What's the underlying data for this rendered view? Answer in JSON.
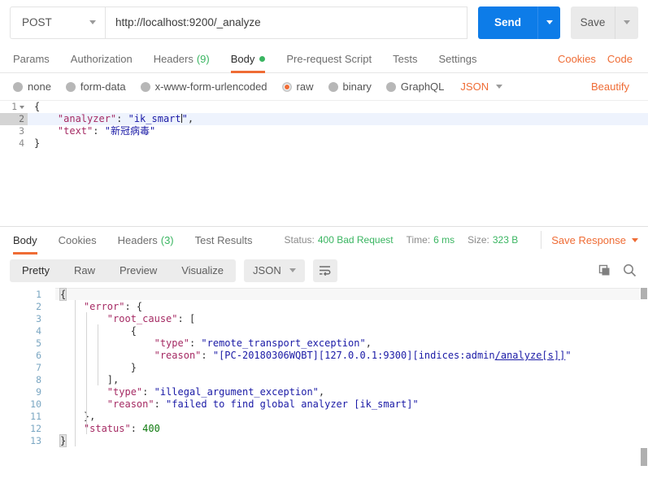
{
  "request": {
    "method": "POST",
    "url": "http://localhost:9200/_analyze",
    "send_label": "Send",
    "save_label": "Save",
    "tabs": [
      {
        "label": "Params",
        "count": "",
        "active": false,
        "dot": false
      },
      {
        "label": "Authorization",
        "count": "",
        "active": false,
        "dot": false
      },
      {
        "label": "Headers",
        "count": "(9)",
        "active": false,
        "dot": false
      },
      {
        "label": "Body",
        "count": "",
        "active": true,
        "dot": true
      },
      {
        "label": "Pre-request Script",
        "count": "",
        "active": false,
        "dot": false
      },
      {
        "label": "Tests",
        "count": "",
        "active": false,
        "dot": false
      },
      {
        "label": "Settings",
        "count": "",
        "active": false,
        "dot": false
      }
    ],
    "cookies_label": "Cookies",
    "code_label": "Code",
    "body_types": [
      {
        "label": "none",
        "selected": false
      },
      {
        "label": "form-data",
        "selected": false
      },
      {
        "label": "x-www-form-urlencoded",
        "selected": false
      },
      {
        "label": "raw",
        "selected": true
      },
      {
        "label": "binary",
        "selected": false
      },
      {
        "label": "GraphQL",
        "selected": false
      }
    ],
    "raw_format": "JSON",
    "beautify_label": "Beautify",
    "body_lines": [
      {
        "num": "1",
        "fold": true,
        "highlight": false,
        "segs": [
          {
            "t": "{",
            "c": "p"
          }
        ]
      },
      {
        "num": "2",
        "fold": false,
        "highlight": true,
        "segs": [
          {
            "t": "    ",
            "c": "p"
          },
          {
            "t": "\"analyzer\"",
            "c": "k"
          },
          {
            "t": ": ",
            "c": "p"
          },
          {
            "t": "\"ik_smart",
            "c": "s"
          },
          {
            "t": "CURSOR",
            "c": "cursor"
          },
          {
            "t": "\"",
            "c": "s"
          },
          {
            "t": ",",
            "c": "p"
          }
        ]
      },
      {
        "num": "3",
        "fold": false,
        "highlight": false,
        "segs": [
          {
            "t": "    ",
            "c": "p"
          },
          {
            "t": "\"text\"",
            "c": "k"
          },
          {
            "t": ": ",
            "c": "p"
          },
          {
            "t": "\"新冠病毒\"",
            "c": "s"
          }
        ]
      },
      {
        "num": "4",
        "fold": false,
        "highlight": false,
        "segs": [
          {
            "t": "}",
            "c": "p"
          }
        ]
      }
    ]
  },
  "response": {
    "tabs": [
      {
        "label": "Body",
        "count": "",
        "active": true
      },
      {
        "label": "Cookies",
        "count": "",
        "active": false
      },
      {
        "label": "Headers",
        "count": "(3)",
        "active": false
      },
      {
        "label": "Test Results",
        "count": "",
        "active": false
      }
    ],
    "status_label": "Status:",
    "status_value": "400 Bad Request",
    "time_label": "Time:",
    "time_value": "6 ms",
    "size_label": "Size:",
    "size_value": "323 B",
    "save_response_label": "Save Response",
    "view_modes": [
      {
        "label": "Pretty",
        "active": true
      },
      {
        "label": "Raw",
        "active": false
      },
      {
        "label": "Preview",
        "active": false
      },
      {
        "label": "Visualize",
        "active": false
      }
    ],
    "format": "JSON",
    "body_lines": [
      {
        "num": "1",
        "segs": [
          {
            "t": "{",
            "c": "brhl"
          }
        ]
      },
      {
        "num": "2",
        "segs": [
          {
            "t": "    ",
            "c": "p"
          },
          {
            "t": "\"error\"",
            "c": "rk"
          },
          {
            "t": ": {",
            "c": "p"
          }
        ]
      },
      {
        "num": "3",
        "segs": [
          {
            "t": "        ",
            "c": "p"
          },
          {
            "t": "\"root_cause\"",
            "c": "rk"
          },
          {
            "t": ": [",
            "c": "p"
          }
        ]
      },
      {
        "num": "4",
        "segs": [
          {
            "t": "            {",
            "c": "p"
          }
        ]
      },
      {
        "num": "5",
        "segs": [
          {
            "t": "                ",
            "c": "p"
          },
          {
            "t": "\"type\"",
            "c": "rk"
          },
          {
            "t": ": ",
            "c": "p"
          },
          {
            "t": "\"remote_transport_exception\"",
            "c": "rs"
          },
          {
            "t": ",",
            "c": "p"
          }
        ]
      },
      {
        "num": "6",
        "segs": [
          {
            "t": "                ",
            "c": "p"
          },
          {
            "t": "\"reason\"",
            "c": "rk"
          },
          {
            "t": ": ",
            "c": "p"
          },
          {
            "t": "\"[PC-20180306WQBT][127.0.0.1:9300][indices:admin",
            "c": "rs"
          },
          {
            "t": "/analyze[s]]",
            "c": "rs ulink"
          },
          {
            "t": "\"",
            "c": "rs"
          }
        ]
      },
      {
        "num": "7",
        "segs": [
          {
            "t": "            }",
            "c": "p"
          }
        ]
      },
      {
        "num": "8",
        "segs": [
          {
            "t": "        ],",
            "c": "p"
          }
        ]
      },
      {
        "num": "9",
        "segs": [
          {
            "t": "        ",
            "c": "p"
          },
          {
            "t": "\"type\"",
            "c": "rk"
          },
          {
            "t": ": ",
            "c": "p"
          },
          {
            "t": "\"illegal_argument_exception\"",
            "c": "rs"
          },
          {
            "t": ",",
            "c": "p"
          }
        ]
      },
      {
        "num": "10",
        "segs": [
          {
            "t": "        ",
            "c": "p"
          },
          {
            "t": "\"reason\"",
            "c": "rk"
          },
          {
            "t": ": ",
            "c": "p"
          },
          {
            "t": "\"failed to find global analyzer [ik_smart]\"",
            "c": "rs"
          }
        ]
      },
      {
        "num": "11",
        "segs": [
          {
            "t": "    },",
            "c": "p"
          }
        ]
      },
      {
        "num": "12",
        "segs": [
          {
            "t": "    ",
            "c": "p"
          },
          {
            "t": "\"status\"",
            "c": "rk"
          },
          {
            "t": ": ",
            "c": "p"
          },
          {
            "t": "400",
            "c": "rn"
          }
        ]
      },
      {
        "num": "13",
        "segs": [
          {
            "t": "}",
            "c": "brhl"
          }
        ]
      }
    ]
  },
  "icons": {
    "chevron_down": "chevron-down-icon",
    "copy": "copy-icon",
    "search": "search-icon",
    "word_wrap": "word-wrap-icon"
  },
  "colors": {
    "accent_blue": "#0d7ce8",
    "accent_orange": "#ef6c35",
    "status_green": "#3ab561"
  }
}
